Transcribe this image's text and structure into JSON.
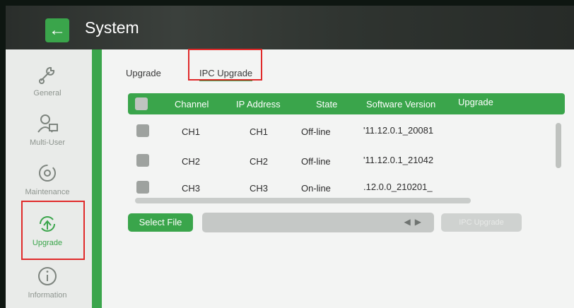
{
  "window": {
    "title": "System"
  },
  "sidebar": {
    "items": [
      {
        "label": "General",
        "icon": "wrench-icon",
        "active": false
      },
      {
        "label": "Multi-User",
        "icon": "user-icon",
        "active": false
      },
      {
        "label": "Maintenance",
        "icon": "maintenance-icon",
        "active": false
      },
      {
        "label": "Upgrade",
        "icon": "upgrade-icon",
        "active": true
      },
      {
        "label": "Information",
        "icon": "info-icon",
        "active": false
      }
    ]
  },
  "tabs": [
    {
      "label": "Upgrade",
      "active": false
    },
    {
      "label": "IPC Upgrade",
      "active": true
    }
  ],
  "table": {
    "columns": [
      "Channel",
      "IP Address",
      "State",
      "Software Version",
      "Upgrade"
    ],
    "rows": [
      {
        "channel": "CH1",
        "ip": "CH1",
        "state": "Off-line",
        "version": "'11.12.0.1_20081",
        "upgrade": ""
      },
      {
        "channel": "CH2",
        "ip": "CH2",
        "state": "Off-line",
        "version": "'11.12.0.1_21042",
        "upgrade": ""
      },
      {
        "channel": "CH3",
        "ip": "CH3",
        "state": "On-line",
        "version": ".12.0.0_210201_",
        "upgrade": ""
      }
    ]
  },
  "actions": {
    "select_file_label": "Select File",
    "file_path_value": "",
    "ipc_upgrade_label": "IPC Upgrade"
  },
  "colors": {
    "accent": "#3aa54b",
    "highlight": "#e02a2a",
    "topbar": "#2f3430"
  }
}
